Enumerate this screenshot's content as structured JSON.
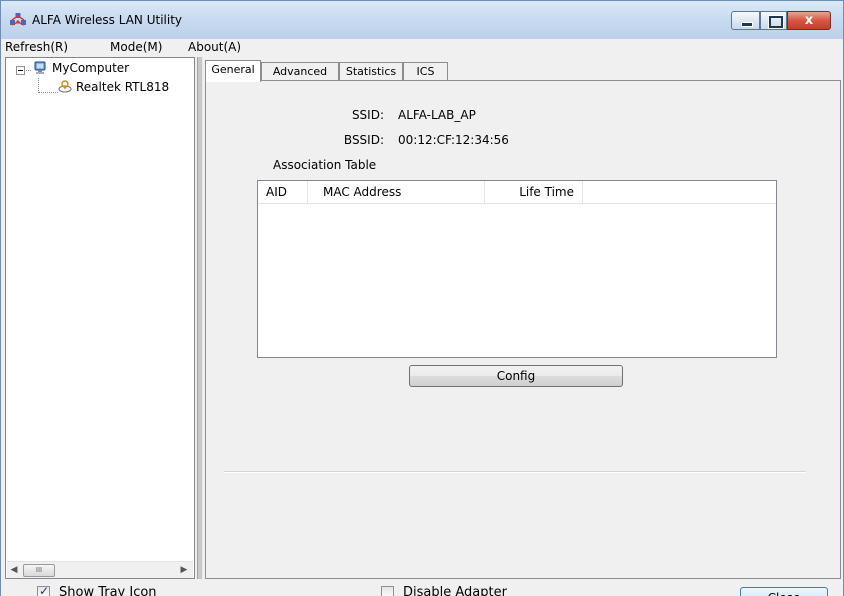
{
  "window": {
    "title": "ALFA Wireless LAN Utility",
    "close_glyph": "x"
  },
  "menu": {
    "items": [
      {
        "label": "Refresh(R)"
      },
      {
        "label": "Mode(M)"
      },
      {
        "label": "About(A)"
      }
    ]
  },
  "tree": {
    "root_label": "MyComputer",
    "child_label": "Realtek RTL818",
    "scroll_thumb": "III"
  },
  "tabs": [
    {
      "label": "General",
      "active": true
    },
    {
      "label": "Advanced",
      "active": false
    },
    {
      "label": "Statistics",
      "active": false
    },
    {
      "label": "ICS",
      "active": false
    }
  ],
  "general": {
    "ssid_label": "SSID:",
    "ssid_value": "ALFA-LAB_AP",
    "bssid_label": "BSSID:",
    "bssid_value": "00:12:CF:12:34:56",
    "assoc_title": "Association Table",
    "columns": [
      "AID",
      "MAC Address",
      "Life Time"
    ],
    "rows": [],
    "config_label": "Config"
  },
  "footer": {
    "show_tray_label": "Show Tray Icon",
    "show_tray_checked": true,
    "disable_adapter_label": "Disable Adapter",
    "disable_adapter_checked": false,
    "close_label": "Close"
  },
  "icons": {
    "app": "wireless-network-icon",
    "computer": "computer-icon",
    "adapter": "wireless-adapter-icon"
  },
  "colors": {
    "title_bar": "#c8daf0",
    "close_button": "#d6563f",
    "window_bg": "#f0f0f0"
  }
}
